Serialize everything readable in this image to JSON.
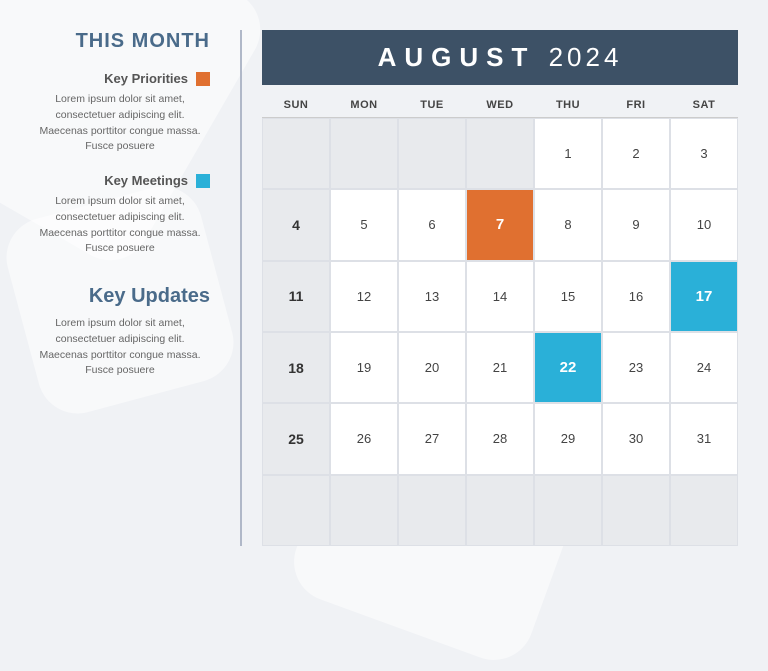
{
  "sidebar": {
    "title": "THIS MONTH",
    "priorities": {
      "label": "Key Priorities",
      "color": "orange",
      "text": "Lorem ipsum dolor sit amet, consectetuer adipiscing elit. Maecenas porttitor congue massa. Fusce posuere"
    },
    "meetings": {
      "label": "Key Meetings",
      "color": "blue",
      "text": "Lorem ipsum dolor sit amet, consectetuer adipiscing elit. Maecenas porttitor congue massa. Fusce posuere"
    },
    "updates": {
      "title": "Key Updates",
      "text": "Lorem ipsum dolor sit amet, consectetuer adipiscing elit. Maecenas porttitor congue massa. Fusce posuere"
    }
  },
  "calendar": {
    "month": "AUGUST",
    "year": "2024",
    "days_header": [
      "SUN",
      "MON",
      "TUE",
      "WED",
      "THU",
      "FRI",
      "SAT"
    ],
    "weeks": [
      {
        "sun": null,
        "mon": null,
        "tue": null,
        "wed": null,
        "thu": "1",
        "fri": "2",
        "sat": "3"
      },
      {
        "sun": "4",
        "mon": "5",
        "tue": "6",
        "wed": "7",
        "thu": "8",
        "fri": "9",
        "sat": "10"
      },
      {
        "sun": "11",
        "mon": "12",
        "tue": "13",
        "wed": "14",
        "thu": "15",
        "fri": "16",
        "sat": "17"
      },
      {
        "sun": "18",
        "mon": "19",
        "tue": "20",
        "wed": "21",
        "thu": "22",
        "fri": "23",
        "sat": "24"
      },
      {
        "sun": "25",
        "mon": "26",
        "tue": "27",
        "wed": "28",
        "thu": "29",
        "fri": "30",
        "sat": "31"
      },
      {
        "sun": null,
        "mon": null,
        "tue": null,
        "wed": null,
        "thu": null,
        "fri": null,
        "sat": null
      }
    ],
    "highlighted_orange": [
      "7"
    ],
    "highlighted_blue": [
      "17",
      "22"
    ]
  }
}
